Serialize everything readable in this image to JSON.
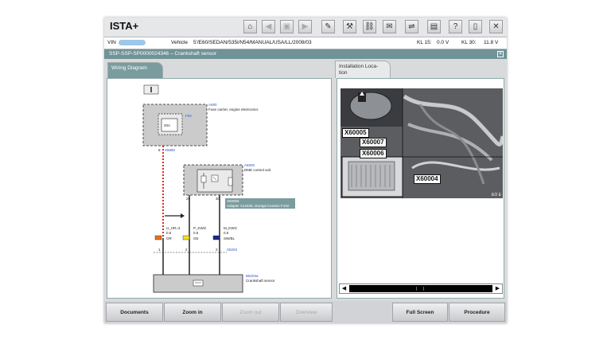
{
  "app": {
    "title": "ISTA+",
    "toolbar": [
      {
        "name": "home-icon",
        "glyph": "⌂"
      },
      {
        "name": "back-icon",
        "glyph": "◀"
      },
      {
        "name": "print-disabled-icon",
        "glyph": "▣"
      },
      {
        "name": "forward-icon",
        "glyph": "▶"
      },
      {
        "name": "wrench-icon",
        "glyph": "✎"
      },
      {
        "name": "tool-icon",
        "glyph": "⚒"
      },
      {
        "name": "link-icon",
        "glyph": "⛓"
      },
      {
        "name": "mail-icon",
        "glyph": "✉"
      },
      {
        "name": "connection-icon",
        "glyph": "⇌"
      },
      {
        "name": "battery-icon",
        "glyph": "▤"
      },
      {
        "name": "help-icon",
        "glyph": "?"
      },
      {
        "name": "info-icon",
        "glyph": "▯"
      },
      {
        "name": "close-icon",
        "glyph": "✕"
      }
    ]
  },
  "infobar": {
    "vin_label": "VIN",
    "vehicle_label": "Vehicle",
    "vehicle_value": "5'/E60/SEDAN/535i/N54/MANUAL/USA/LL/2008/03",
    "kl15_label": "KL 15:",
    "kl15_value": "0.0 V",
    "kl30_label": "KL 30:",
    "kl30_value": "11.8 V"
  },
  "document": {
    "title": "SSP-SSP-SP0000024346  –  Crankshaft sensor"
  },
  "tabs": {
    "wiring": "Wiring Diagram",
    "installation_line1": "Installation Loca-",
    "installation_line2": "tion"
  },
  "wiring": {
    "a680_id": "A680",
    "a680_desc": "Fuse carrier, engine electronics",
    "f03_id": "F03",
    "fuse_rating": "20A",
    "x6680_id": "X6680",
    "a6000_id": "A6000",
    "a6000_desc": "DME control unit",
    "x60005_id": "X60005",
    "x60005_desc": "Adapter X12426, storage location F102",
    "pin8": "8",
    "pin29": "29",
    "pin30": "30",
    "wire1_name": "U_HR=3",
    "wire1_size": "0.5",
    "wire1_color": "OR",
    "wire2_name": "P_KWG",
    "wire2_size": "0.5",
    "wire2_color": "GE",
    "wire3_name": "M_KWG",
    "wire3_size": "0.5",
    "wire3_color": "SW/BL",
    "pin1": "1",
    "pin2": "2",
    "pin3": "2",
    "x8203_id": "X8203",
    "b6203_id": "B6203a",
    "b6203_desc": "Crankshaft sensor",
    "colors": {
      "or": "#e8731a",
      "ge": "#f0e020",
      "swbl": "#1a2a8a",
      "highlight": "#d92b2b"
    }
  },
  "photo": {
    "labels": [
      "X60005",
      "X60007",
      "X60006",
      "X60004"
    ],
    "corner_text": "EO E"
  },
  "bottom": {
    "documents": "Documents",
    "zoom_in": "Zoom in",
    "zoom_out": "Zoom out",
    "overview": "Overview",
    "full_screen": "Full Screen",
    "procedure": "Procedure"
  }
}
